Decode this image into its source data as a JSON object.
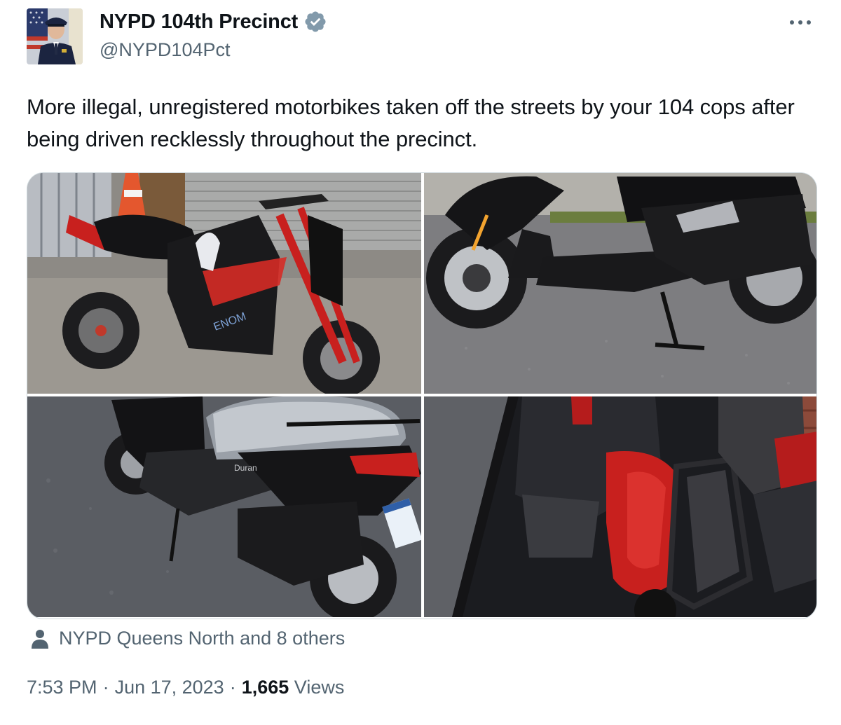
{
  "author": {
    "name": "NYPD 104th Precinct",
    "handle": "@NYPD104Pct",
    "verified_badge_icon": "verified-badge-icon",
    "avatar_icon": "avatar-officer-photo"
  },
  "more_icon": "ellipsis-icon",
  "tweet": {
    "text": "More illegal, unregistered motorbikes taken off the streets by your 104 cops after being driven recklessly throughout the precinct."
  },
  "media": [
    {
      "icon": "photo-motorbike-red-black"
    },
    {
      "icon": "photo-scooter-black"
    },
    {
      "icon": "photo-scooter-plated"
    },
    {
      "icon": "photo-scooter-red-closeup"
    }
  ],
  "tagged": {
    "icon": "person-icon",
    "label": "NYPD Queens North and 8 others"
  },
  "meta": {
    "time": "7:53 PM",
    "separator": "·",
    "date": "Jun 17, 2023",
    "views_count": "1,665",
    "views_label": "Views"
  },
  "colors": {
    "text_primary": "#0f1419",
    "text_secondary": "#536471",
    "verified": "#829aab",
    "border": "#cfd9de"
  }
}
